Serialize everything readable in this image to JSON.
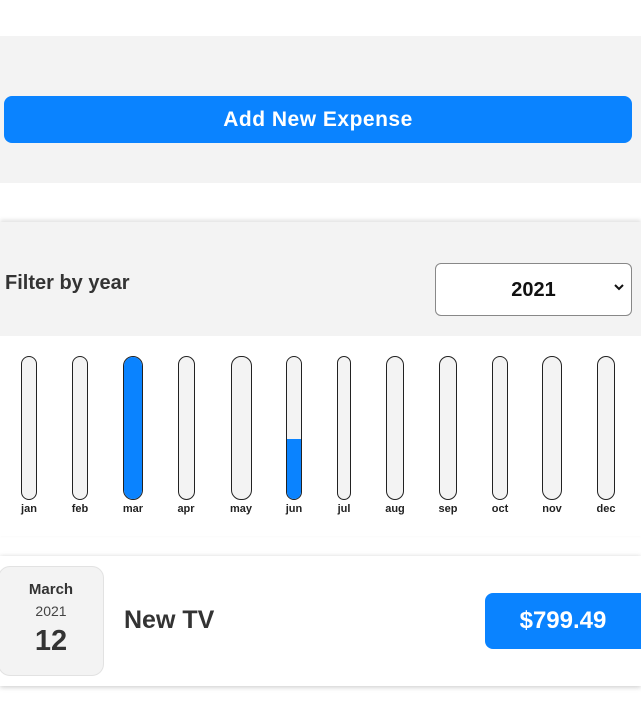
{
  "new_expense": {
    "add_button_label": "Add New Expense"
  },
  "filter": {
    "label": "Filter by year",
    "selected_year": "2021"
  },
  "chart_data": {
    "type": "bar",
    "categories": [
      "jan",
      "feb",
      "mar",
      "apr",
      "may",
      "jun",
      "jul",
      "aug",
      "sep",
      "oct",
      "nov",
      "dec"
    ],
    "values": [
      0,
      0,
      1.0,
      0,
      0,
      0.42,
      0,
      0,
      0,
      0,
      0,
      0
    ],
    "ylim": [
      0,
      1
    ],
    "fill_color": "#0a83ff",
    "track_color": "#f3f3f3"
  },
  "expenses": [
    {
      "month": "March",
      "year": "2021",
      "day": "12",
      "title": "New TV",
      "amount": "$799.49"
    }
  ],
  "colors": {
    "accent": "#0a83ff",
    "panel_background": "#f3f3f3",
    "text": "#333333"
  }
}
